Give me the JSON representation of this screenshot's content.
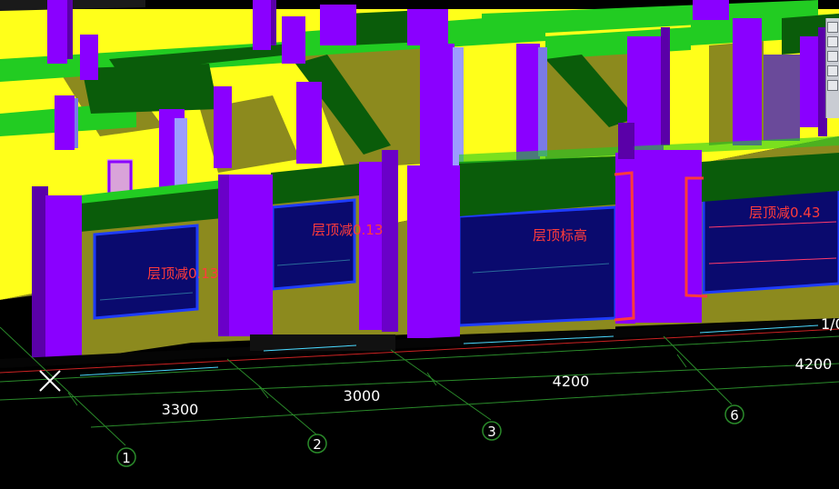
{
  "dimensions": [
    "3300",
    "3000",
    "4200",
    "4200"
  ],
  "axis_labels": [
    "1",
    "2",
    "3",
    "6"
  ],
  "annotations": [
    "层顶减0.13",
    "层顶减0.13",
    "层顶标高",
    "层顶减0.43"
  ],
  "partial_label": "1/0",
  "colors": {
    "background": "#000000",
    "wall_yellow": "#ffff1a",
    "wall_olive": "#8c8a1e",
    "column_purple": "#8a00ff",
    "beam_green": "#22cc22",
    "beam_dark_green": "#0a5c0a",
    "window_blue": "#0a0a6e",
    "grid_green": "#2a8a2a",
    "annotation_red": "#ff3b3b"
  },
  "icons": [
    "crosshair-icon",
    "orbit-icon",
    "zoom-icon",
    "layers-icon"
  ]
}
